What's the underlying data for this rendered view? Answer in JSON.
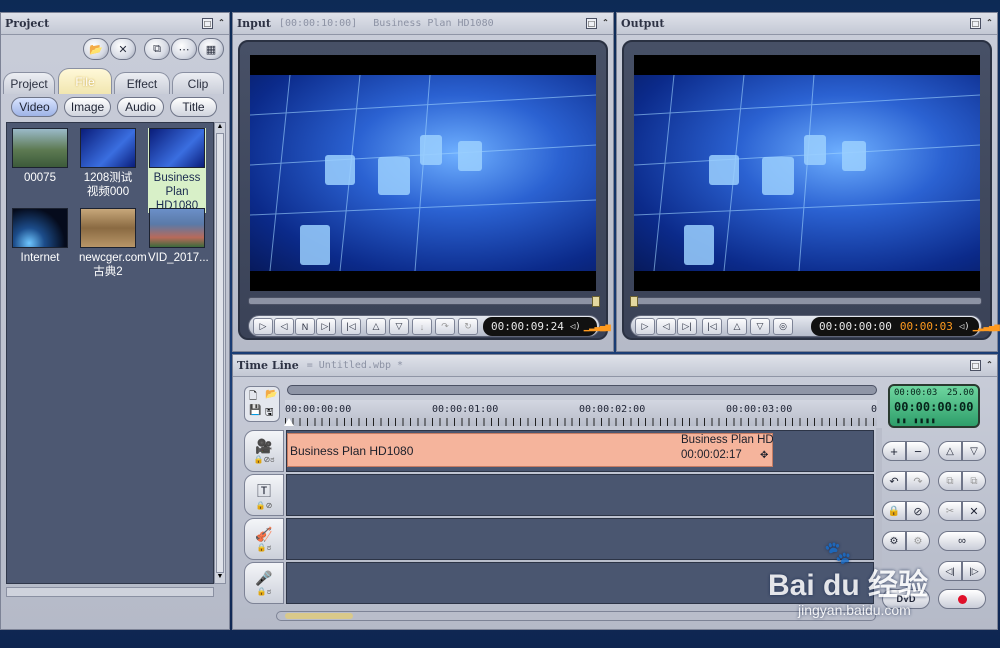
{
  "project": {
    "title": "Project",
    "tabs": [
      "Project",
      "File",
      "Effect",
      "Clip"
    ],
    "active_tab": "File",
    "filters": [
      "Video",
      "Image",
      "Audio",
      "Title"
    ],
    "active_filter": "Video",
    "media": [
      {
        "label": "00075"
      },
      {
        "label": "1208测试视频000"
      },
      {
        "label": "Business Plan HD1080",
        "selected": true
      },
      {
        "label": "Internet"
      },
      {
        "label": "newcger.com古典2"
      },
      {
        "label": "VID_2017..."
      }
    ]
  },
  "input": {
    "title": "Input",
    "timecode_header": "[00:00:10:00]",
    "clip_name": "Business Plan HD1080",
    "timecode": "00:00:09:24"
  },
  "output": {
    "title": "Output",
    "timecode": "00:00:00:00",
    "timecode_secondary": "00:00:03"
  },
  "timeline": {
    "title": "Time Line",
    "file": "= Untitled.wbp *",
    "ruler": [
      "00:00:00:00",
      "00:00:01:00",
      "00:00:02:00",
      "00:00:03:00"
    ],
    "ruler_end": "0",
    "clip": {
      "name": "Business Plan HD1080",
      "name_right": "Business Plan HD",
      "duration": "00:00:02:17"
    },
    "lcd": {
      "top_left": "00:00:03",
      "top_right": "25.00",
      "main": "00:00:00:00"
    },
    "dvd_label": "DVD"
  },
  "watermark": {
    "brand": "Bai  du 经验",
    "url": "jingyan.baidu.com"
  }
}
